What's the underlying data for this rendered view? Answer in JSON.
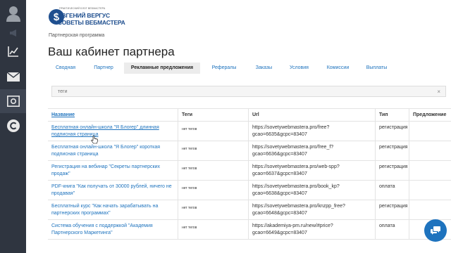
{
  "logo": {
    "tagline": "ПРАКТИЧЕСКИЙ БЛОГ ВЕБМАСТЕРА",
    "line1": "ЕВГЕНИЙ ВЕРГУС",
    "line2": "СОВЕТЫ ВЕБМАСТЕРА"
  },
  "breadcrumb": "Партнерская программа",
  "page_title": "Ваш кабинет партнера",
  "tabs": [
    {
      "label": "Сводная"
    },
    {
      "label": "Партнер"
    },
    {
      "label": "Рекламные предложения",
      "active": true
    },
    {
      "label": "Рефералы"
    },
    {
      "label": "Заказы"
    },
    {
      "label": "Условия"
    },
    {
      "label": "Комиссии"
    },
    {
      "label": "Выплаты"
    }
  ],
  "search": {
    "placeholder": "теги",
    "clear": "×"
  },
  "table": {
    "headers": [
      "Название",
      "Теги",
      "Url",
      "Тип",
      "Предложение"
    ],
    "rows": [
      {
        "name": "Бесплатная онлайн-школа \"Я Блогер\" длинная подписная страница",
        "tags": "нет тегов",
        "url": "https://sovetywebmastera.pro/free?gcao=6635&gcpc=83407",
        "type": "регистрация",
        "offer": ""
      },
      {
        "name": "Бесплатная онлайн-школа \"Я Блогер\" короткая подписная страница",
        "tags": "нет тегов",
        "url": "https://sovetywebmastera.pro/free_f?gcao=6636&gcpc=83407",
        "type": "регистрация",
        "offer": ""
      },
      {
        "name": "Регистрация на вебинар \"Секреты партнерских продаж\"",
        "tags": "нет тегов",
        "url": "https://sovetywebmastera.pro/web-spp?gcao=6637&gcpc=83407",
        "type": "регистрация",
        "offer": ""
      },
      {
        "name": "PDF-книга \"Как получать от 30000 рублей, ничего не продавая\"",
        "tags": "нет тегов",
        "url": "https://sovetywebmastera.pro/book_kp?gcao=6638&gcpc=83407",
        "type": "оплата",
        "offer": ""
      },
      {
        "name": "Бесплатный курс \"Как начать зарабатывать на партнерских программах\"",
        "tags": "нет тегов",
        "url": "https://sovetywebmastera.pro/knzpp_free?gcao=6648&gcpc=83407",
        "type": "регистрация",
        "offer": ""
      },
      {
        "name": "Система обучения с поддержкой \"Академия Партнерского Маркетинга\"",
        "tags": "нет тегов",
        "url": "https://akademiya-pm.ru/new/#price?gcao=6649&gcpc=83407",
        "type": "оплата",
        "offer": ""
      }
    ]
  },
  "sidebar_icons": [
    "user-avatar-icon",
    "megaphone-icon",
    "chart-icon",
    "mail-icon",
    "safe-icon",
    "chat-logo-icon"
  ],
  "colors": {
    "accent": "#1e73be",
    "sidebar": "#2f3540"
  }
}
